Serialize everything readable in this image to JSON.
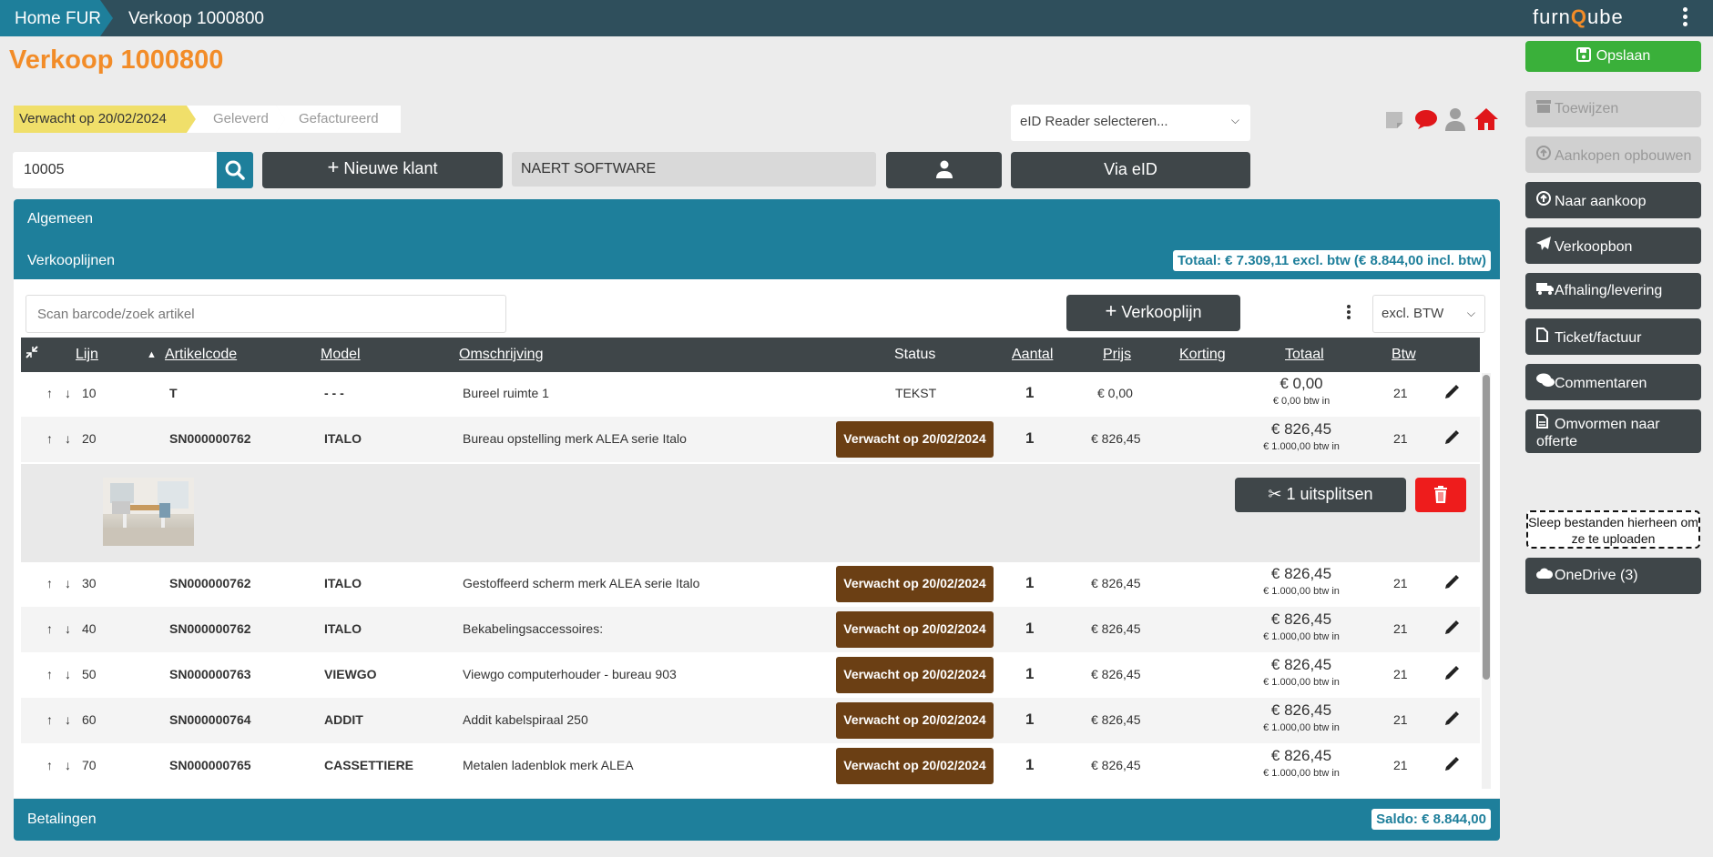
{
  "topbar": {
    "home_label": "Home FUR",
    "current": "Verkoop 1000800",
    "logo_pre": "furn",
    "logo_q": "Q",
    "logo_post": "ube"
  },
  "page_title": "Verkoop 1000800",
  "steps": [
    "Verwacht op 20/02/2024",
    "Geleverd",
    "Gefactureerd"
  ],
  "eid_select": "eID Reader selecteren...",
  "customer": {
    "number": "10005",
    "new_client_label": "Nieuwe klant",
    "name": "NAERT SOFTWARE",
    "eid_label": "Via eID"
  },
  "sections": {
    "algemeen": "Algemeen",
    "verkooplijnen": "Verkooplijnen",
    "total_badge": "Totaal: € 7.309,11 excl. btw (€ 8.844,00 incl. btw)",
    "betalingen": "Betalingen",
    "saldo_badge": "Saldo: € 8.844,00"
  },
  "lines_toolbar": {
    "scan_placeholder": "Scan barcode/zoek artikel",
    "add_line_label": "Verkooplijn",
    "btw_select": "excl. BTW"
  },
  "table": {
    "headers": {
      "lijn": "Lijn",
      "artikelcode": "Artikelcode",
      "model": "Model",
      "omschrijving": "Omschrijving",
      "status": "Status",
      "aantal": "Aantal",
      "prijs": "Prijs",
      "korting": "Korting",
      "totaal": "Totaal",
      "btw": "Btw"
    },
    "rows": [
      {
        "lijn": "10",
        "code": "T",
        "model": "- - -",
        "desc": "Bureel ruimte 1",
        "status": "TEKST",
        "qty": "1",
        "price": "€ 0,00",
        "total": "€ 0,00",
        "total_sub": "€ 0,00 btw in",
        "btw": "21"
      },
      {
        "lijn": "20",
        "code": "SN000000762",
        "model": "ITALO",
        "desc": "Bureau opstelling merk ALEA serie Italo",
        "status": "Verwacht op 20/02/2024",
        "qty": "1",
        "price": "€ 826,45",
        "total": "€ 826,45",
        "total_sub": "€ 1.000,00 btw in",
        "btw": "21"
      },
      {
        "lijn": "30",
        "code": "SN000000762",
        "model": "ITALO",
        "desc": "Gestoffeerd scherm merk ALEA serie Italo",
        "status": "Verwacht op 20/02/2024",
        "qty": "1",
        "price": "€ 826,45",
        "total": "€ 826,45",
        "total_sub": "€ 1.000,00 btw in",
        "btw": "21"
      },
      {
        "lijn": "40",
        "code": "SN000000762",
        "model": "ITALO",
        "desc": "Bekabelingsaccessoires:",
        "status": "Verwacht op 20/02/2024",
        "qty": "1",
        "price": "€ 826,45",
        "total": "€ 826,45",
        "total_sub": "€ 1.000,00 btw in",
        "btw": "21"
      },
      {
        "lijn": "50",
        "code": "SN000000763",
        "model": "VIEWGO",
        "desc": "Viewgo computerhouder - bureau 903",
        "status": "Verwacht op 20/02/2024",
        "qty": "1",
        "price": "€ 826,45",
        "total": "€ 826,45",
        "total_sub": "€ 1.000,00 btw in",
        "btw": "21"
      },
      {
        "lijn": "60",
        "code": "SN000000764",
        "model": "ADDIT",
        "desc": "Addit kabelspiraal 250",
        "status": "Verwacht op 20/02/2024",
        "qty": "1",
        "price": "€ 826,45",
        "total": "€ 826,45",
        "total_sub": "€ 1.000,00 btw in",
        "btw": "21"
      },
      {
        "lijn": "70",
        "code": "SN000000765",
        "model": "CASSETTIERE",
        "desc": "Metalen ladenblok merk ALEA",
        "status": "Verwacht op 20/02/2024",
        "qty": "1",
        "price": "€ 826,45",
        "total": "€ 826,45",
        "total_sub": "€ 1.000,00 btw in",
        "btw": "21"
      }
    ],
    "split_label": "1 uitsplitsen"
  },
  "sidebar": {
    "save": "Opslaan",
    "buttons": [
      {
        "label": "Toewijzen",
        "icon": "archive-icon",
        "disabled": true
      },
      {
        "label": "Aankopen opbouwen",
        "icon": "circle-arrow-up-icon",
        "disabled": true
      },
      {
        "label": "Naar aankoop",
        "icon": "circle-arrow-up-icon",
        "disabled": false
      },
      {
        "label": "Verkoopbon",
        "icon": "paper-plane-icon",
        "disabled": false
      },
      {
        "label": "Afhaling/levering",
        "icon": "truck-icon",
        "disabled": false
      },
      {
        "label": "Ticket/factuur",
        "icon": "file-icon",
        "disabled": false
      },
      {
        "label": "Commentaren",
        "icon": "comments-icon",
        "disabled": false
      },
      {
        "label": "Omvormen naar offerte",
        "icon": "file-alt-icon",
        "disabled": false
      }
    ],
    "dropzone": "Sleep bestanden hierheen om ze te uploaden",
    "onedrive": "OneDrive (3)"
  },
  "colors": {
    "accent": "#1e7f9b",
    "title": "#f28c28",
    "status_pill": "#6b3f14",
    "save": "#3ab03a",
    "delete": "#ee1c1c",
    "dark": "#3f4649"
  }
}
